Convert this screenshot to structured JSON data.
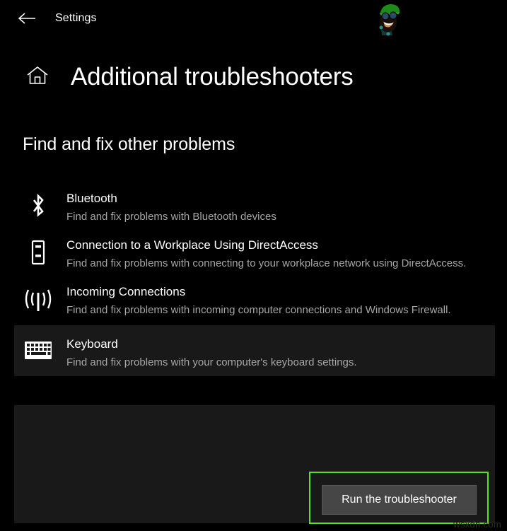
{
  "titlebar": {
    "back_icon": "back-arrow-icon",
    "app_title": "Settings",
    "avatar": "cartoon-avatar-watermark"
  },
  "header": {
    "home_icon": "home-icon",
    "page_title": "Additional troubleshooters"
  },
  "section": {
    "heading": "Find and fix other problems"
  },
  "troubleshooters": [
    {
      "icon": "bluetooth-icon",
      "name": "Bluetooth",
      "description": "Find and fix problems with Bluetooth devices",
      "highlighted": false
    },
    {
      "icon": "workplace-device-icon",
      "name": "Connection to a Workplace Using DirectAccess",
      "description": "Find and fix problems with connecting to your workplace network using DirectAccess.",
      "highlighted": false
    },
    {
      "icon": "incoming-connections-icon",
      "name": "Incoming Connections",
      "description": "Find and fix problems with incoming computer connections and Windows Firewall.",
      "highlighted": false
    },
    {
      "icon": "keyboard-icon",
      "name": "Keyboard",
      "description": "Find and fix problems with your computer's keyboard settings.",
      "highlighted": true
    }
  ],
  "action": {
    "run_button_label": "Run the troubleshooter",
    "highlight_color": "#5ce01e",
    "button_background": "#464646"
  },
  "watermark": {
    "text": "wsxdn.com"
  },
  "colors": {
    "page_background": "#000000",
    "panel_background": "#191919",
    "primary_text": "#ffffff",
    "secondary_text": "#a6a6a6",
    "highlight_green": "#5ce01e"
  }
}
